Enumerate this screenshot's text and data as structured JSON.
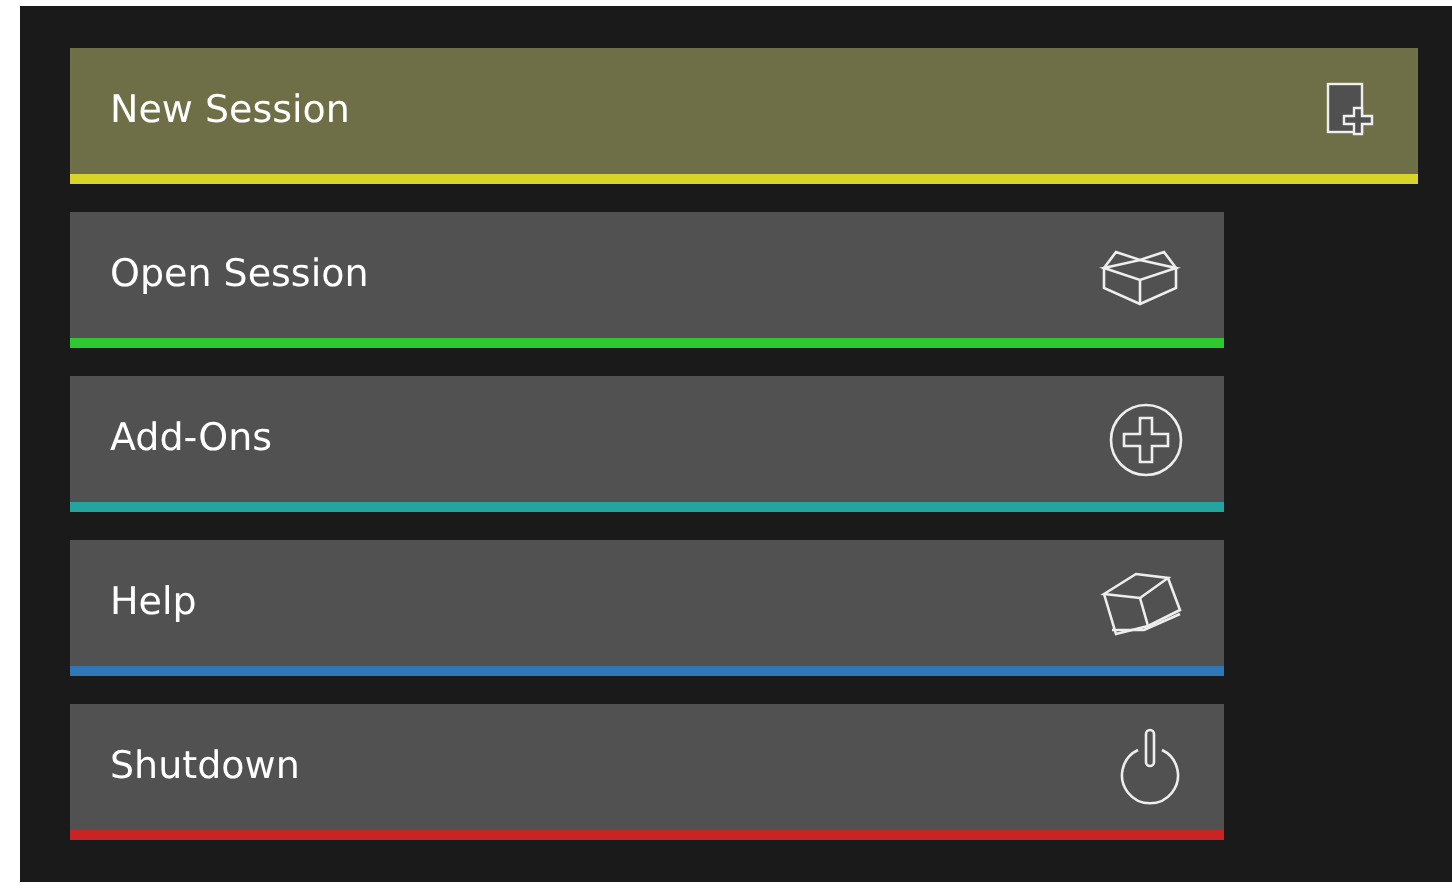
{
  "menu": [
    {
      "label": "New Session",
      "kind": "new",
      "selected": true,
      "color": "#d8d42a"
    },
    {
      "label": "Open Session",
      "kind": "open",
      "selected": false,
      "color": "#2ec92e"
    },
    {
      "label": "Add-Ons",
      "kind": "addons",
      "selected": false,
      "color": "#22a5a0"
    },
    {
      "label": "Help",
      "kind": "help",
      "selected": false,
      "color": "#2f78b8"
    },
    {
      "label": "Shutdown",
      "kind": "power",
      "selected": false,
      "color": "#c82424"
    }
  ]
}
